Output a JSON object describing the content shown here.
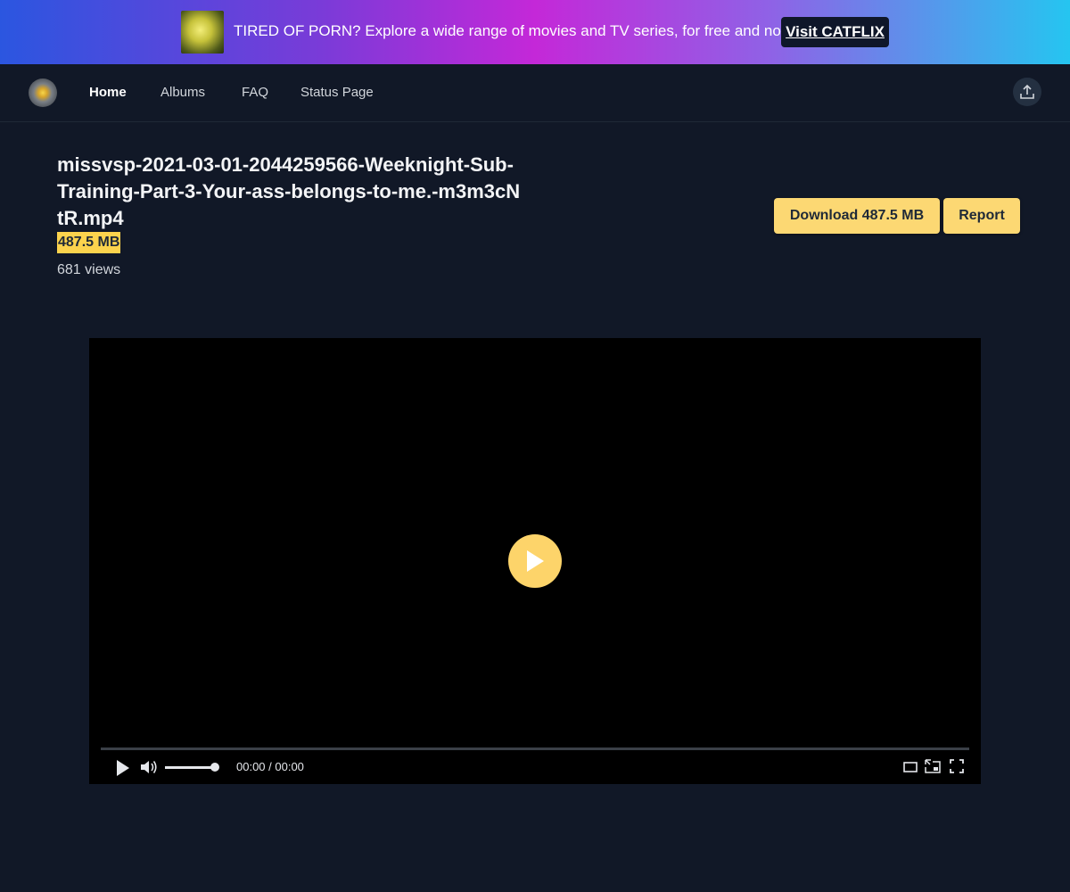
{
  "banner": {
    "text": "TIRED OF PORN? Explore a wide range of movies and TV series, for free and no ads.",
    "link_label": "Visit CATFLIX"
  },
  "nav": {
    "items": [
      {
        "label": "Home",
        "active": true
      },
      {
        "label": "Albums",
        "active": false
      },
      {
        "label": "FAQ",
        "active": false
      },
      {
        "label": "Status Page",
        "active": false
      }
    ],
    "upload_icon": "upload-icon"
  },
  "file": {
    "name": "missvsp-2021-03-01-2044259566-Weeknight-Sub-Training-Part-3-Your-ass-belongs-to-me.-m3m3cNtR.mp4",
    "size": "487.5 MB",
    "views": "681 views"
  },
  "actions": {
    "download_label": "Download 487.5 MB",
    "report_label": "Report"
  },
  "player": {
    "time": "00:00 / 00:00",
    "volume_fraction": 0.9,
    "progress_fraction": 0.0
  },
  "colors": {
    "accent": "#fcd34d",
    "background": "#111827"
  }
}
